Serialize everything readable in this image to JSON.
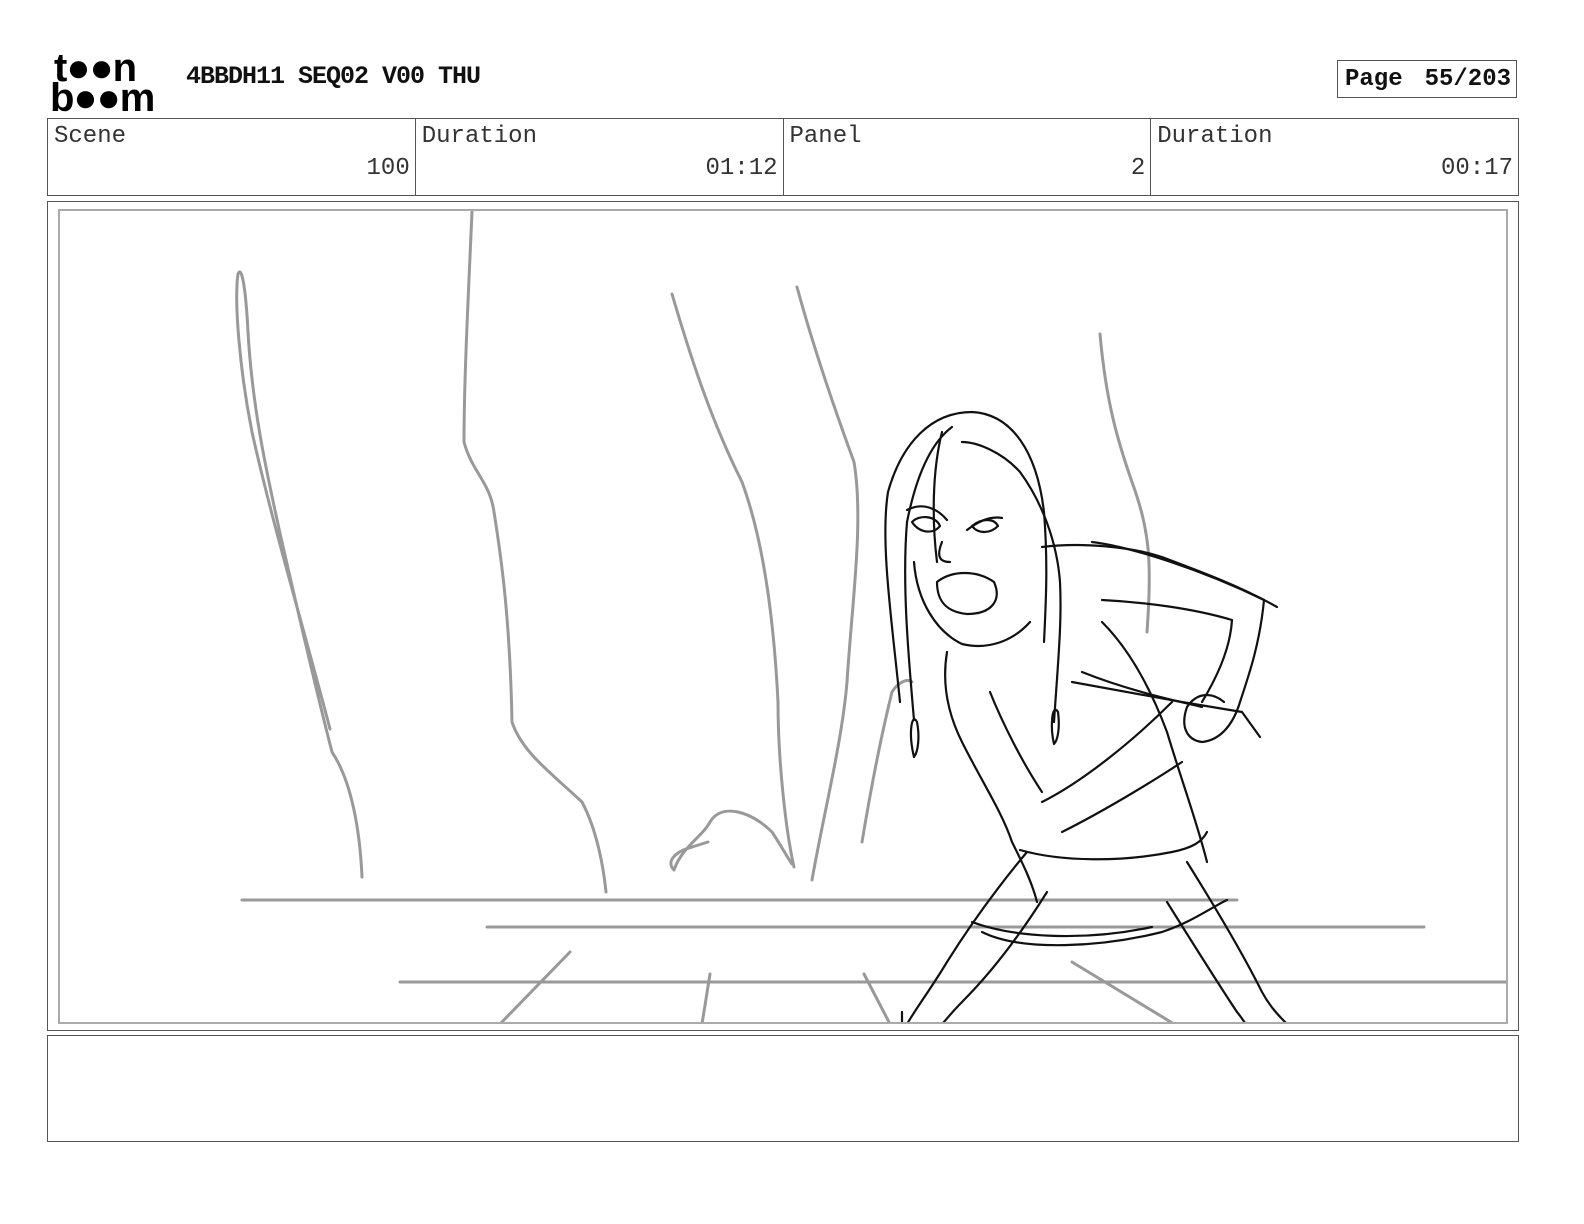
{
  "logo": {
    "line1": "t●●n",
    "line2": "b●●m",
    "alt": "toon boom"
  },
  "document": {
    "title": "4BBDH11 SEQ02 V00 THU"
  },
  "page": {
    "label": "Page",
    "number": "55/203"
  },
  "info": [
    {
      "label": "Scene",
      "value": "100"
    },
    {
      "label": "Duration",
      "value": "01:12"
    },
    {
      "label": "Panel",
      "value": "2"
    },
    {
      "label": "Duration",
      "value": "00:17"
    }
  ],
  "notes": {
    "text": ""
  },
  "colors": {
    "border": "#555555",
    "sketch_background": "#999999",
    "sketch_character": "#111111"
  }
}
